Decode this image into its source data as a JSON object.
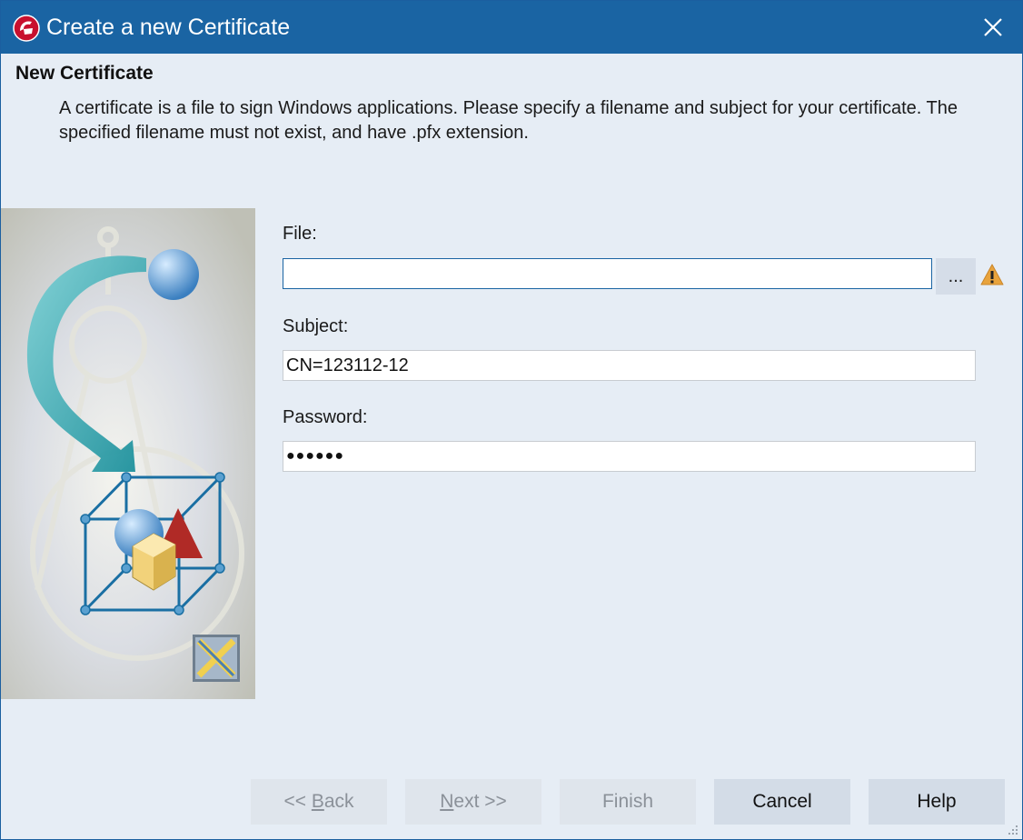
{
  "window": {
    "title": "Create a new Certificate",
    "titlebar_color": "#1a64a3"
  },
  "header": {
    "title": "New Certificate",
    "description": "A certificate is a file to sign Windows applications. Please specify a filename and subject for your certificate. The specified filename must not exist, and have .pfx extension."
  },
  "form": {
    "file": {
      "label": "File:",
      "value": "",
      "browse_label": "...",
      "warning_icon": "warning-icon"
    },
    "subject": {
      "label": "Subject:",
      "value": "CN=123112-12"
    },
    "password": {
      "label": "Password:",
      "value": "●●●●●●"
    }
  },
  "buttons": {
    "back": {
      "pre": "<< ",
      "accel": "B",
      "post": "ack",
      "enabled": false
    },
    "next": {
      "pre": "",
      "accel": "N",
      "post": "ext >>",
      "enabled": false
    },
    "finish": {
      "label": "Finish",
      "enabled": false
    },
    "cancel": {
      "label": "Cancel",
      "enabled": true
    },
    "help": {
      "label": "Help",
      "enabled": true
    }
  }
}
